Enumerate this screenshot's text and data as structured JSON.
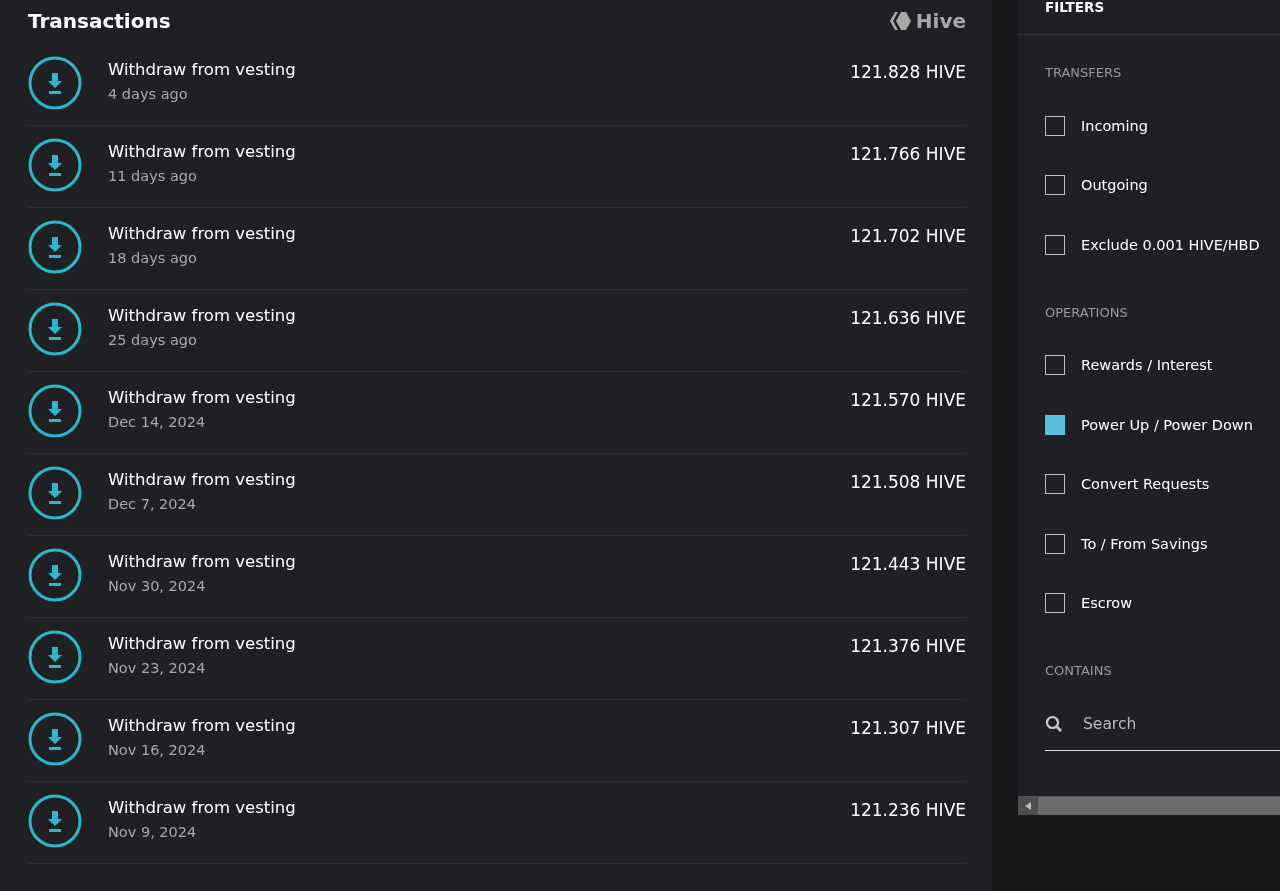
{
  "transactions": {
    "title": "Transactions",
    "brand": "Hive",
    "rows": [
      {
        "title": "Withdraw from vesting",
        "time": "4 days ago",
        "amount": "121.828 HIVE"
      },
      {
        "title": "Withdraw from vesting",
        "time": "11 days ago",
        "amount": "121.766 HIVE"
      },
      {
        "title": "Withdraw from vesting",
        "time": "18 days ago",
        "amount": "121.702 HIVE"
      },
      {
        "title": "Withdraw from vesting",
        "time": "25 days ago",
        "amount": "121.636 HIVE"
      },
      {
        "title": "Withdraw from vesting",
        "time": "Dec 14, 2024",
        "amount": "121.570 HIVE"
      },
      {
        "title": "Withdraw from vesting",
        "time": "Dec 7, 2024",
        "amount": "121.508 HIVE"
      },
      {
        "title": "Withdraw from vesting",
        "time": "Nov 30, 2024",
        "amount": "121.443 HIVE"
      },
      {
        "title": "Withdraw from vesting",
        "time": "Nov 23, 2024",
        "amount": "121.376 HIVE"
      },
      {
        "title": "Withdraw from vesting",
        "time": "Nov 16, 2024",
        "amount": "121.307 HIVE"
      },
      {
        "title": "Withdraw from vesting",
        "time": "Nov 9, 2024",
        "amount": "121.236 HIVE"
      }
    ]
  },
  "filters": {
    "title": "FILTERS",
    "groups": [
      {
        "heading": "TRANSFERS",
        "options": [
          {
            "label": "Incoming",
            "checked": false
          },
          {
            "label": "Outgoing",
            "checked": false
          },
          {
            "label": "Exclude 0.001 HIVE/HBD",
            "checked": false
          }
        ]
      },
      {
        "heading": "OPERATIONS",
        "options": [
          {
            "label": "Rewards / Interest",
            "checked": false
          },
          {
            "label": "Power Up / Power Down",
            "checked": true
          },
          {
            "label": "Convert Requests",
            "checked": false
          },
          {
            "label": "To / From Savings",
            "checked": false
          },
          {
            "label": "Escrow",
            "checked": false
          }
        ]
      }
    ],
    "contains": {
      "heading": "CONTAINS",
      "placeholder": "Search"
    }
  }
}
